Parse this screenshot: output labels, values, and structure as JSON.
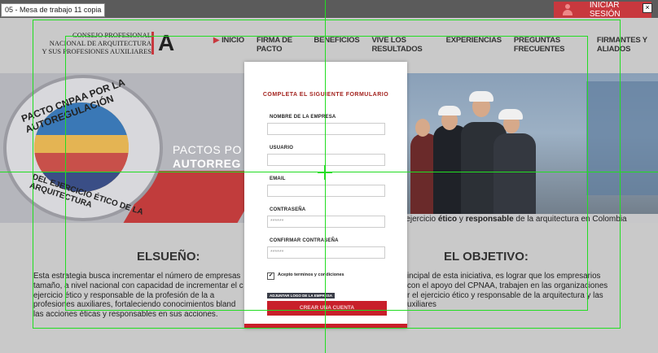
{
  "window": {
    "artboard_label": "05 - Mesa de trabajo 11 copia",
    "close_glyph": "×"
  },
  "auth": {
    "login_label": "INICIAR SESIÓN"
  },
  "brand": {
    "line1": "CONSEJO PROFESIONAL",
    "line2": "NACIONAL DE ARQUITECTURA",
    "line3": "Y SUS PROFESIONES AUXILIARES",
    "mark": "A"
  },
  "nav": {
    "items": [
      "INICIO",
      "FIRMA DE PACTO",
      "BENEFICIOS",
      "VIVE LOS RESULTADOS",
      "EXPERIENCIAS",
      "PREGUNTAS FRECUENTES",
      "FIRMANTES Y ALIADOS"
    ]
  },
  "hero": {
    "badge_top": "PACTO CNPAA POR LA AUTOREGULACIÓN",
    "badge_bottom": "DEL EJERCICIO ÉTICO DE LA ARQUITECTURA",
    "headline_1": "PACTOS PO",
    "headline_2": "AUTORREG",
    "caption_pre": "n ejercicio ",
    "caption_b1": "ético",
    "caption_mid": " y ",
    "caption_b2": "responsable",
    "caption_post": " de la arquitectura en Colombia"
  },
  "sections": {
    "sueno_title": "ELSUEÑO:",
    "sueno_lines": [
      "Esta estrategia busca incrementar el número de empresas",
      "tamaño, a nivel nacional con capacidad de incrementar el c",
      "ejercicio ético y responsable de la profesión de la a",
      "profesiones auxiliares, fortaleciendo conocimientos bland",
      "las acciones éticas y responsables  en sus acciones."
    ],
    "objetivo_title": "EL OBJETIVO:",
    "objetivo_lines": [
      "incipal de esta iniciativa, es lograr que los empresarios",
      "con el apoyo del CPNAA, trabajen en las organizaciones",
      "r el ejercicio ético y responsable de la arquitectura y las",
      "uxiliares"
    ]
  },
  "form": {
    "title": "COMPLETA EL SIGUIENTE FORMULARIO",
    "company_label": "NOMBRE DE LA EMPRESA",
    "company_value": "",
    "user_label": "USUARIO",
    "user_value": "",
    "email_label": "EMAIL",
    "email_value": "",
    "password_label": "CONTRASEÑA",
    "password_value": "******",
    "confirm_label": "CONFIRMAR CONTRASEÑA",
    "confirm_value": "******",
    "terms_check": "✔",
    "terms_label": "Acepto terminos y condiciones",
    "upload_label": "ADJUNTAR LOGO DE LA EMPRESA",
    "submit_label": "CREAR UNA CUENTA"
  },
  "colors": {
    "accent": "#c81f2a",
    "guides": "#22dd22",
    "title_red": "#a3231f"
  }
}
